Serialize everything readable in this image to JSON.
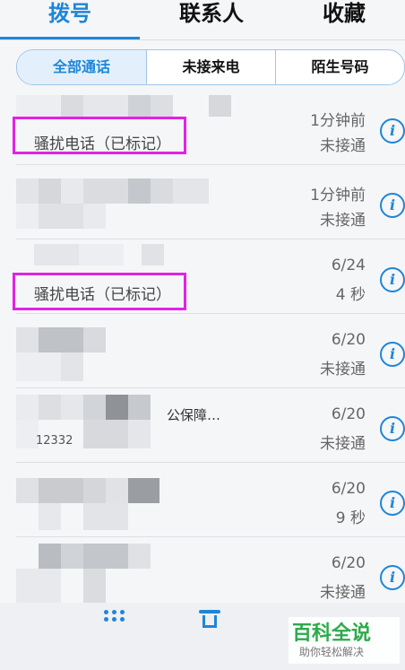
{
  "tabs": [
    {
      "label": "拨号",
      "active": true
    },
    {
      "label": "联系人",
      "active": false
    },
    {
      "label": "收藏",
      "active": false
    }
  ],
  "filters": [
    {
      "label": "全部通话",
      "active": true
    },
    {
      "label": "未接来电",
      "active": false
    },
    {
      "label": "陌生号码",
      "active": false
    }
  ],
  "calls": [
    {
      "tag": "骚扰电话（已标记）",
      "time": "1分钟前",
      "status": "未接通"
    },
    {
      "tag": "",
      "time": "1分钟前",
      "status": "未接通"
    },
    {
      "tag": "骚扰电话（已标记）",
      "time": "6/24",
      "status": "4 秒"
    },
    {
      "tag": "",
      "time": "6/20",
      "status": "未接通"
    },
    {
      "tag": "",
      "partial": "公保障…",
      "partial2": "12332",
      "time": "6/20",
      "status": "未接通"
    },
    {
      "tag": "",
      "time": "6/20",
      "status": "9 秒"
    },
    {
      "tag": "",
      "time": "6/20",
      "status": "未接通"
    }
  ],
  "bottom": {
    "dialpad_icon": "dialpad-icon",
    "delete_icon": "trash-icon"
  },
  "watermark": {
    "title": "百科全说",
    "subtitle": "助你轻松解决"
  },
  "colors": {
    "accent": "#1e86d8",
    "highlight_box": "#e321e6",
    "watermark_green": "#2daa4a"
  }
}
